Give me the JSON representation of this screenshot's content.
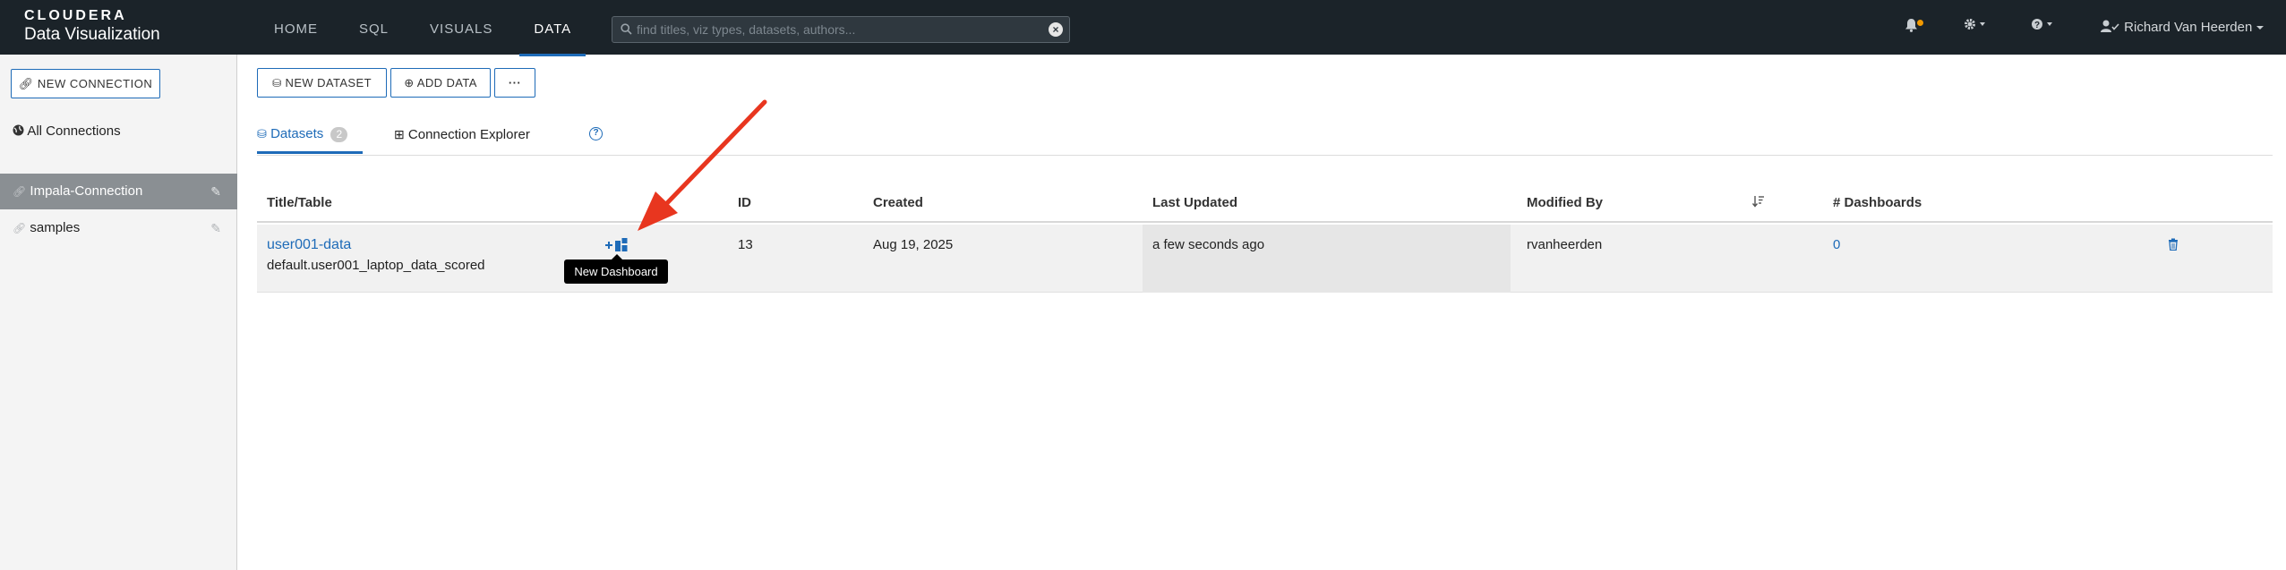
{
  "topbar": {
    "logo": "CLOUDERA",
    "app_name": "Data Visualization",
    "nav": [
      {
        "label": "HOME"
      },
      {
        "label": "SQL"
      },
      {
        "label": "VISUALS"
      },
      {
        "label": "DATA",
        "active": true
      }
    ],
    "search_placeholder": "find titles, viz types, datasets, authors...",
    "user_name": "Richard Van Heerden",
    "notification_dot_color": "#f29900"
  },
  "sidebar": {
    "new_connection_label": "NEW CONNECTION",
    "all_connections_label": "All Connections",
    "connections": [
      {
        "label": "Impala-Connection",
        "selected": true
      },
      {
        "label": "samples",
        "selected": false
      }
    ]
  },
  "toolbar": {
    "new_dataset_label": "NEW DATASET",
    "add_data_label": "ADD DATA",
    "more_label": "···"
  },
  "tabs": {
    "datasets_label": "Datasets",
    "datasets_count": "2",
    "explorer_label": "Connection Explorer"
  },
  "table": {
    "headers": {
      "title": "Title/Table",
      "id": "ID",
      "created": "Created",
      "last_updated": "Last Updated",
      "modified_by": "Modified By",
      "dashboards": "# Dashboards"
    },
    "rows": [
      {
        "title": "user001-data",
        "table": "default.user001_laptop_data_scored",
        "id": "13",
        "created": "Aug 19, 2025",
        "last_updated": "a few seconds ago",
        "modified_by": "rvanheerden",
        "dashboards": "0"
      }
    ],
    "tooltip": "New Dashboard"
  },
  "colors": {
    "accent": "#1e6bb8",
    "topbar_bg": "#1b2329",
    "annotation_arrow": "#e8361f"
  }
}
